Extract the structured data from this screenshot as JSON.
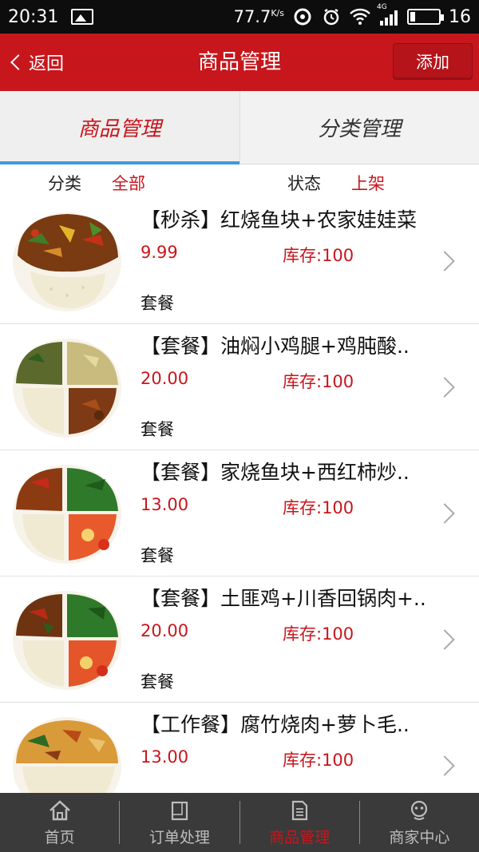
{
  "status_bar": {
    "time": "20:31",
    "speed": "77.7",
    "speed_unit": "K/s",
    "network": "4G",
    "battery": "16"
  },
  "header": {
    "back_label": "返回",
    "title": "商品管理",
    "add_label": "添加"
  },
  "tabs": [
    {
      "label": "商品管理",
      "active": true
    },
    {
      "label": "分类管理",
      "active": false
    }
  ],
  "filters": {
    "category_label": "分类",
    "category_value": "全部",
    "status_label": "状态",
    "status_value": "上架"
  },
  "products": [
    {
      "name": "【秒杀】红烧鱼块+农家娃娃菜",
      "price": "9.99",
      "stock": "库存:100",
      "type": "套餐",
      "image": "meal-photo-1"
    },
    {
      "name": "【套餐】油焖小鸡腿+鸡肫酸..",
      "price": "20.00",
      "stock": "库存:100",
      "type": "套餐",
      "image": "meal-photo-2"
    },
    {
      "name": "【套餐】家烧鱼块+西红柿炒..",
      "price": "13.00",
      "stock": "库存:100",
      "type": "套餐",
      "image": "meal-photo-3"
    },
    {
      "name": "【套餐】土匪鸡+川香回锅肉+..",
      "price": "20.00",
      "stock": "库存:100",
      "type": "套餐",
      "image": "meal-photo-4"
    },
    {
      "name": "【工作餐】腐竹烧肉+萝卜毛..",
      "price": "13.00",
      "stock": "库存:100",
      "type": "",
      "image": "meal-photo-5"
    }
  ],
  "bottom_nav": [
    {
      "label": "首页",
      "icon": "home-icon",
      "active": false
    },
    {
      "label": "订单处理",
      "icon": "order-icon",
      "active": false
    },
    {
      "label": "商品管理",
      "icon": "document-icon",
      "active": true
    },
    {
      "label": "商家中心",
      "icon": "merchant-icon",
      "active": false
    }
  ],
  "colors": {
    "brand_red": "#c8161d",
    "tab_indicator": "#3e9ad8",
    "nav_bg": "#3a3a3a"
  }
}
